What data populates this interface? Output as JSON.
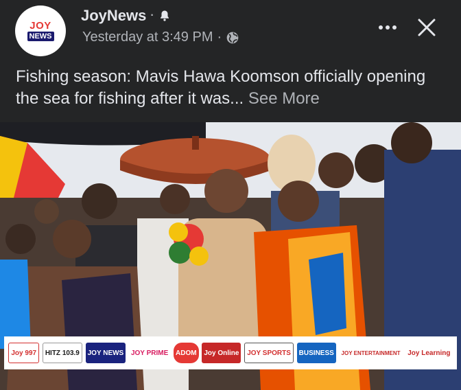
{
  "post": {
    "page_name": "JoyNews",
    "name_separator": "·",
    "timestamp": "Yesterday at 3:49 PM",
    "meta_separator": "·",
    "audience_icon": "globe-icon",
    "notification_icon": "bell-icon",
    "caption_text": "Fishing season: Mavis Hawa Koomson officially opening the sea for fishing after it was",
    "ellipsis": "...",
    "see_more_label": "See More"
  },
  "avatar_logo": {
    "line1": "JOY",
    "line2": "NEWS"
  },
  "media_logos": [
    {
      "label": "Joy 997",
      "color": "#d32f2f",
      "bg": "#ffffff"
    },
    {
      "label": "HITZ 103.9",
      "color": "#1a1a1a",
      "bg": "#ffffff"
    },
    {
      "label": "JOY NEWS",
      "color": "#ffffff",
      "bg": "#1a237e"
    },
    {
      "label": "JOY PRIME",
      "color": "#d81b60",
      "bg": "#ffffff"
    },
    {
      "label": "ADOM",
      "color": "#ffffff",
      "bg": "#e53935"
    },
    {
      "label": "Joy Online",
      "color": "#ffffff",
      "bg": "#c62828"
    },
    {
      "label": "JOY SPORTS",
      "color": "#d32f2f",
      "bg": "#ffffff"
    },
    {
      "label": "BUSINESS",
      "color": "#ffffff",
      "bg": "#1565c0"
    },
    {
      "label": "JOY ENTERTAINMENT",
      "color": "#c62828",
      "bg": "#ffffff"
    },
    {
      "label": "Joy Learning",
      "color": "#c62828",
      "bg": "#ffffff"
    }
  ],
  "colors": {
    "background": "#242526",
    "primary_text": "#e4e6eb",
    "secondary_text": "#b0b3b8",
    "brand_red": "#e53935",
    "brand_blue": "#1a237e"
  }
}
